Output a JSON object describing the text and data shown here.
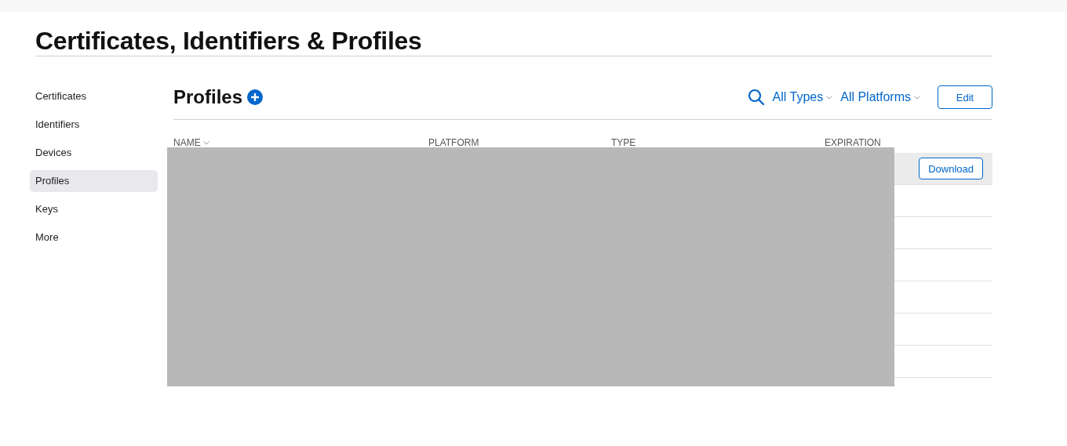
{
  "page_title": "Certificates, Identifiers & Profiles",
  "sidebar": {
    "items": [
      {
        "label": "Certificates",
        "selected": false
      },
      {
        "label": "Identifiers",
        "selected": false
      },
      {
        "label": "Devices",
        "selected": false
      },
      {
        "label": "Profiles",
        "selected": true
      },
      {
        "label": "Keys",
        "selected": false
      },
      {
        "label": "More",
        "selected": false
      }
    ]
  },
  "section": {
    "title": "Profiles",
    "filters": [
      {
        "label": "All Types"
      },
      {
        "label": "All Platforms"
      }
    ],
    "edit_button": "Edit"
  },
  "table": {
    "columns": [
      {
        "label": "NAME",
        "sorted": true
      },
      {
        "label": "PLATFORM",
        "sorted": false
      },
      {
        "label": "TYPE",
        "sorted": false
      },
      {
        "label": "EXPIRATION",
        "sorted": false
      }
    ],
    "rows": [
      {
        "selected": true,
        "action": "Download"
      },
      {
        "selected": false
      },
      {
        "selected": false
      },
      {
        "selected": false
      },
      {
        "selected": false
      },
      {
        "selected": false
      },
      {
        "selected": false
      }
    ],
    "redacted": true
  }
}
